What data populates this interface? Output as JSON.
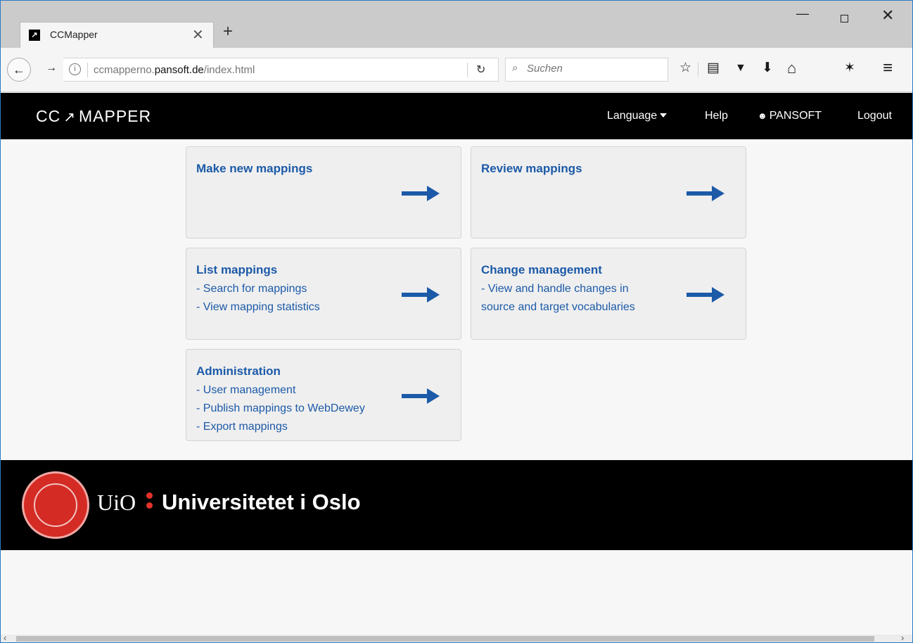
{
  "browser": {
    "tab": {
      "favicon": "↗",
      "title": "CCMapper",
      "close": "✕"
    },
    "new_tab": "+",
    "window_controls": {
      "minimize": "—",
      "close": "✕"
    },
    "back": "←",
    "forward": "→",
    "info": "i",
    "url": {
      "prefix": "ccmapperno.",
      "host": "pansoft.de",
      "path": "/index.html"
    },
    "reload": "↻",
    "search_placeholder": "Suchen",
    "search_glass": "⌕",
    "toolbar_icons": {
      "bookmark": "☆",
      "reading_list": "▤",
      "pocket": "▼",
      "download": "⬇",
      "home": "⌂",
      "extension": "✶",
      "menu": "≡"
    }
  },
  "header": {
    "logo_left": "CC",
    "logo_mark": "↗",
    "logo_right": "MAPPER",
    "nav": {
      "language": "Language",
      "help": "Help",
      "user_icon": "☻",
      "user": "PANSOFT",
      "logout": "Logout"
    }
  },
  "cards": [
    {
      "title": "Make new mappings",
      "lines": []
    },
    {
      "title": "Review mappings",
      "lines": []
    },
    {
      "title": "List mappings",
      "lines": [
        "- Search for mappings",
        "- View mapping statistics"
      ]
    },
    {
      "title": "Change management",
      "lines": [
        "- View and handle changes in",
        "source and target vocabularies"
      ]
    },
    {
      "title": "Administration",
      "lines": [
        "- User management",
        "- Publish mappings to WebDewey",
        "- Export mappings"
      ]
    }
  ],
  "footer": {
    "short_name": "UiO",
    "name": "Universitetet i Oslo"
  },
  "scrollbar": {
    "left": "‹",
    "right": "›"
  },
  "colors": {
    "link_blue": "#1c5aa8",
    "header_bg": "#000000",
    "accent_red": "#d42b25"
  }
}
